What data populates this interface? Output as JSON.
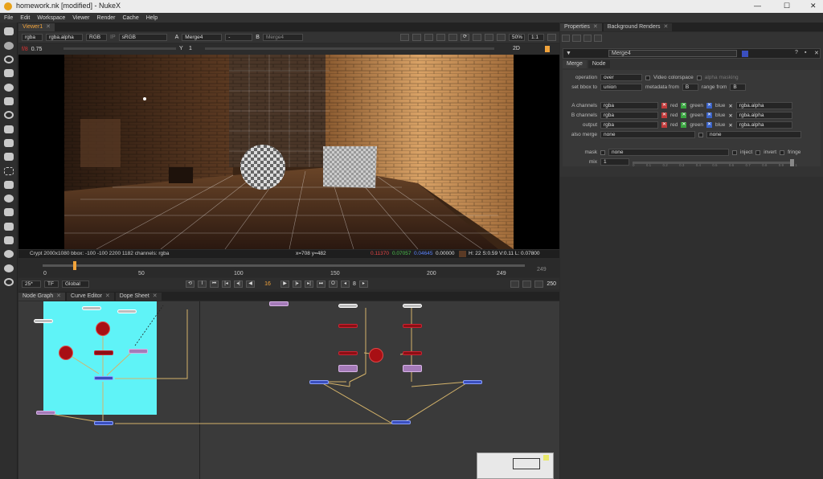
{
  "window": {
    "title": "homework.nk [modified] - NukeX",
    "min": "—",
    "max": "☐",
    "close": "✕"
  },
  "menu": [
    "File",
    "Edit",
    "Workspace",
    "Viewer",
    "Render",
    "Cache",
    "Help"
  ],
  "viewer": {
    "tab": "Viewer1",
    "channels": "rgba",
    "alpha": "rgba.alpha",
    "display": "RGB",
    "ip": "IP",
    "colorspace": "sRGB",
    "a_label": "A",
    "a_input": "Merge4",
    "dash": "-",
    "b_label": "B",
    "b_input": "Merge4",
    "zoom": "50%",
    "ratio": "1:1",
    "gain_label": "f/8",
    "gain": "0.75",
    "gamma_y": "Y",
    "gamma": "1",
    "view2d": "2D",
    "status_left": "Crypt 2000x1080  bbox: -100 -100 2200 1182 channels: rgba",
    "status_xy": "x=708 y=482",
    "status_r": "0.11370",
    "status_g": "0.07057",
    "status_b": "0.04645",
    "status_a": "0.00000",
    "status_hsv": "H: 22 S:0.59 V:0.11  L: 0.07800",
    "timeline": {
      "ticks": [
        "0",
        "50",
        "100",
        "150",
        "200",
        "249"
      ],
      "end": "249",
      "current": "16",
      "fps": "25*",
      "tf": "TF",
      "scope": "Global",
      "step": "8",
      "last": "250"
    }
  },
  "bottom_tabs": [
    "Node Graph",
    "Curve Editor",
    "Dope Sheet"
  ],
  "properties": {
    "tabs": [
      "Properties",
      "Background Renders"
    ],
    "node_name": "Merge4",
    "subtabs": [
      "Merge",
      "Node"
    ],
    "operation_label": "operation",
    "operation": "over",
    "video_colorspace": "Video colorspace",
    "alpha_masking": "alpha masking",
    "set_bbox_label": "set bbox to",
    "set_bbox": "union",
    "metadata_label": "metadata from",
    "metadata": "B",
    "range_label": "range from",
    "range": "B",
    "channel_rows": [
      {
        "label": "A channels",
        "value": "rgba",
        "red": "red",
        "green": "green",
        "blue": "blue",
        "alpha": "rgba.alpha"
      },
      {
        "label": "B channels",
        "value": "rgba",
        "red": "red",
        "green": "green",
        "blue": "blue",
        "alpha": "rgba.alpha"
      },
      {
        "label": "output",
        "value": "rgba",
        "red": "red",
        "green": "green",
        "blue": "blue",
        "alpha": "rgba.alpha"
      }
    ],
    "also_merge_label": "also merge",
    "also_merge": "none",
    "also_merge2": "none",
    "mask_label": "mask",
    "mask": "none",
    "inject": "inject",
    "invert": "invert",
    "fringe": "fringe",
    "mix_label": "mix",
    "mix": "1",
    "mix_ticks": [
      "0",
      "0.1",
      "0.2",
      "0.3",
      "0.4",
      "0.5",
      "0.6",
      "0.7",
      "0.8",
      "0.9",
      "1"
    ]
  },
  "colors": {
    "accent": "#f1a33b",
    "backdrop": "#5ff3f7",
    "node_red": "#8c0f14",
    "node_blue": "#3a4fbf",
    "node_purple": "#a47ab8"
  }
}
